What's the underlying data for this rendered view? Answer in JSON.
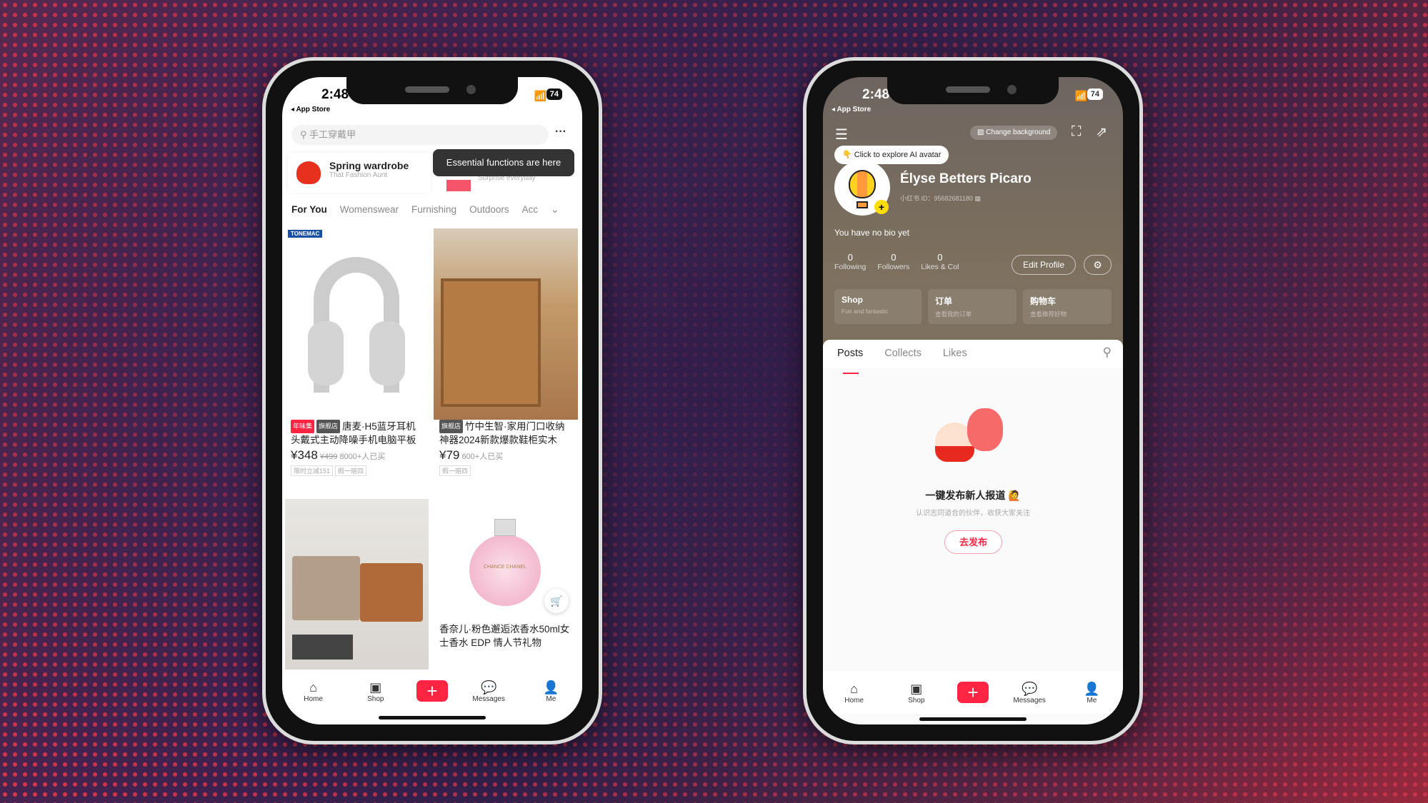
{
  "status": {
    "time": "2:48",
    "back": "App Store",
    "battery": "74"
  },
  "left": {
    "search_placeholder": "手工穿戴甲",
    "more": "···",
    "tooltip": "Essential functions are here",
    "promo": [
      {
        "title": "Spring wardrobe",
        "sub": "That Fashion Aunt"
      },
      {
        "title": "",
        "sub": "Surprise everyday"
      }
    ],
    "tabs": [
      "For You",
      "Womenswear",
      "Furnishing",
      "Outdoors",
      "Acc"
    ],
    "products": [
      {
        "badge": "TONEMAC",
        "tags": [
          "年味集",
          "旗舰店"
        ],
        "title": "唐麦·H5蓝牙耳机头戴式主动降噪手机电脑平板",
        "price": "¥348",
        "old_price": "¥499",
        "sold": "8000+人已买",
        "chips": [
          "限时立减151",
          "假一赔四"
        ]
      },
      {
        "tags": [
          "旗舰店"
        ],
        "title": "竹中生智·家用门口收纳神器2024新款爆款鞋柜实木",
        "price": "¥79",
        "sold": "600+人已买",
        "chips": [
          "假一赔四"
        ]
      },
      {
        "title": ""
      },
      {
        "title": "香奈儿·粉色邂逅浓香水50ml女士香水 EDP 情人节礼物",
        "brand_text": "CHANCE CHANEL"
      }
    ]
  },
  "nav": {
    "home": "Home",
    "shop": "Shop",
    "messages": "Messages",
    "me": "Me"
  },
  "right": {
    "change_bg": "Change background",
    "ai_tip": "Click to explore AI avatar",
    "name": "Élyse Betters Picaro",
    "id": "小红书 ID：95682681180",
    "bio": "You have no bio yet",
    "stats": [
      {
        "n": "0",
        "l": "Following"
      },
      {
        "n": "0",
        "l": "Followers"
      },
      {
        "n": "0",
        "l": "Likes & Col"
      }
    ],
    "edit": "Edit Profile",
    "cards": [
      {
        "t": "Shop",
        "s": "Fun and fantastic"
      },
      {
        "t": "订单",
        "s": "查看我的订单"
      },
      {
        "t": "购物车",
        "s": "查看推荐好物"
      }
    ],
    "tabs": [
      "Posts",
      "Collects",
      "Likes"
    ],
    "empty_title": "一键发布新人报道",
    "empty_sub": "认识志同道合的伙伴，收获大家关注",
    "post_btn": "去发布"
  },
  "colors": {
    "accent": "#ff2442",
    "profile_bg": "#7a6d5c"
  }
}
